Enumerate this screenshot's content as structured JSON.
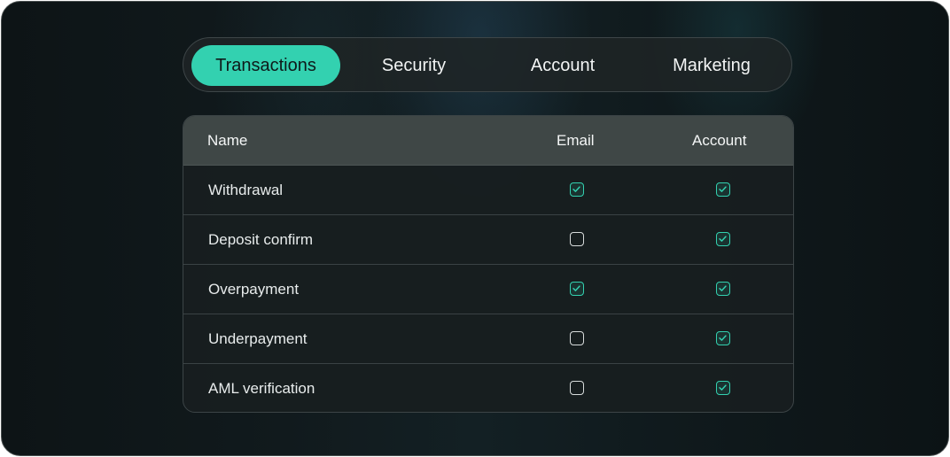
{
  "tabs": [
    {
      "label": "Transactions",
      "active": true
    },
    {
      "label": "Security",
      "active": false
    },
    {
      "label": "Account",
      "active": false
    },
    {
      "label": "Marketing",
      "active": false
    }
  ],
  "table": {
    "headers": {
      "name": "Name",
      "email": "Email",
      "account": "Account"
    },
    "rows": [
      {
        "name": "Withdrawal",
        "email": true,
        "account": true
      },
      {
        "name": "Deposit confirm",
        "email": false,
        "account": true
      },
      {
        "name": "Overpayment",
        "email": true,
        "account": true
      },
      {
        "name": "Underpayment",
        "email": false,
        "account": true
      },
      {
        "name": "AML verification",
        "email": false,
        "account": true
      }
    ]
  },
  "colors": {
    "accent": "#33d1b0",
    "checkbox_unchecked_border": "#d8dcdc",
    "header_bg": "#3f4746"
  },
  "icons": {
    "check": "check-icon"
  }
}
